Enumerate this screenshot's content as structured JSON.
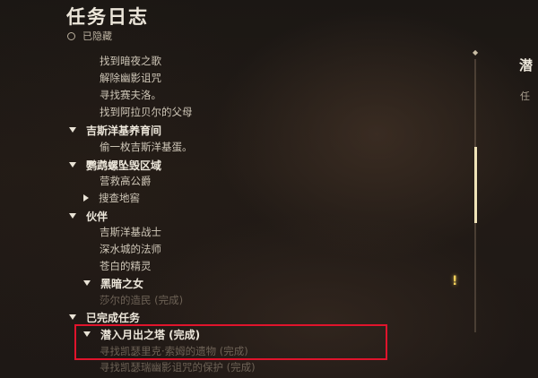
{
  "journal": {
    "title": "任务日志",
    "hidden_label": "已隐藏"
  },
  "quests": {
    "top_items": [
      "找到暗夜之歌",
      "解除幽影诅咒",
      "寻找赛夫洛。",
      "找到阿拉贝尔的父母"
    ],
    "cat_githyanki_creche": "吉斯洋基养育间",
    "item_steal_egg": "偷一枚吉斯洋基蛋。",
    "cat_ruined_area": "鹦鹉螺坠毁区域",
    "item_camp_duke": "营救高公爵",
    "sub_search_cellar": "搜查地窖",
    "cat_companions": "伙伴",
    "companions": [
      "吉斯洋基战士",
      "深水城的法师",
      "苍白的精灵"
    ],
    "sub_dark_urge": "黑暗之女",
    "item_dark_urge_done": "莎尔的造民 (完成)",
    "cat_completed": "已完成任务",
    "sel_moonrise": "潜入月出之塔 (完成)",
    "done_1": "寻找凯瑟里克·索姆的遗物 (完成)",
    "done_2": "寻找凯瑟瑞幽影诅咒的保护 (完成)"
  },
  "right_panel": {
    "heading": "潜",
    "sub": "任"
  },
  "icons": {
    "alert": "!",
    "alert_color": "#f0cf5a",
    "highlight_color": "#e0142c"
  }
}
